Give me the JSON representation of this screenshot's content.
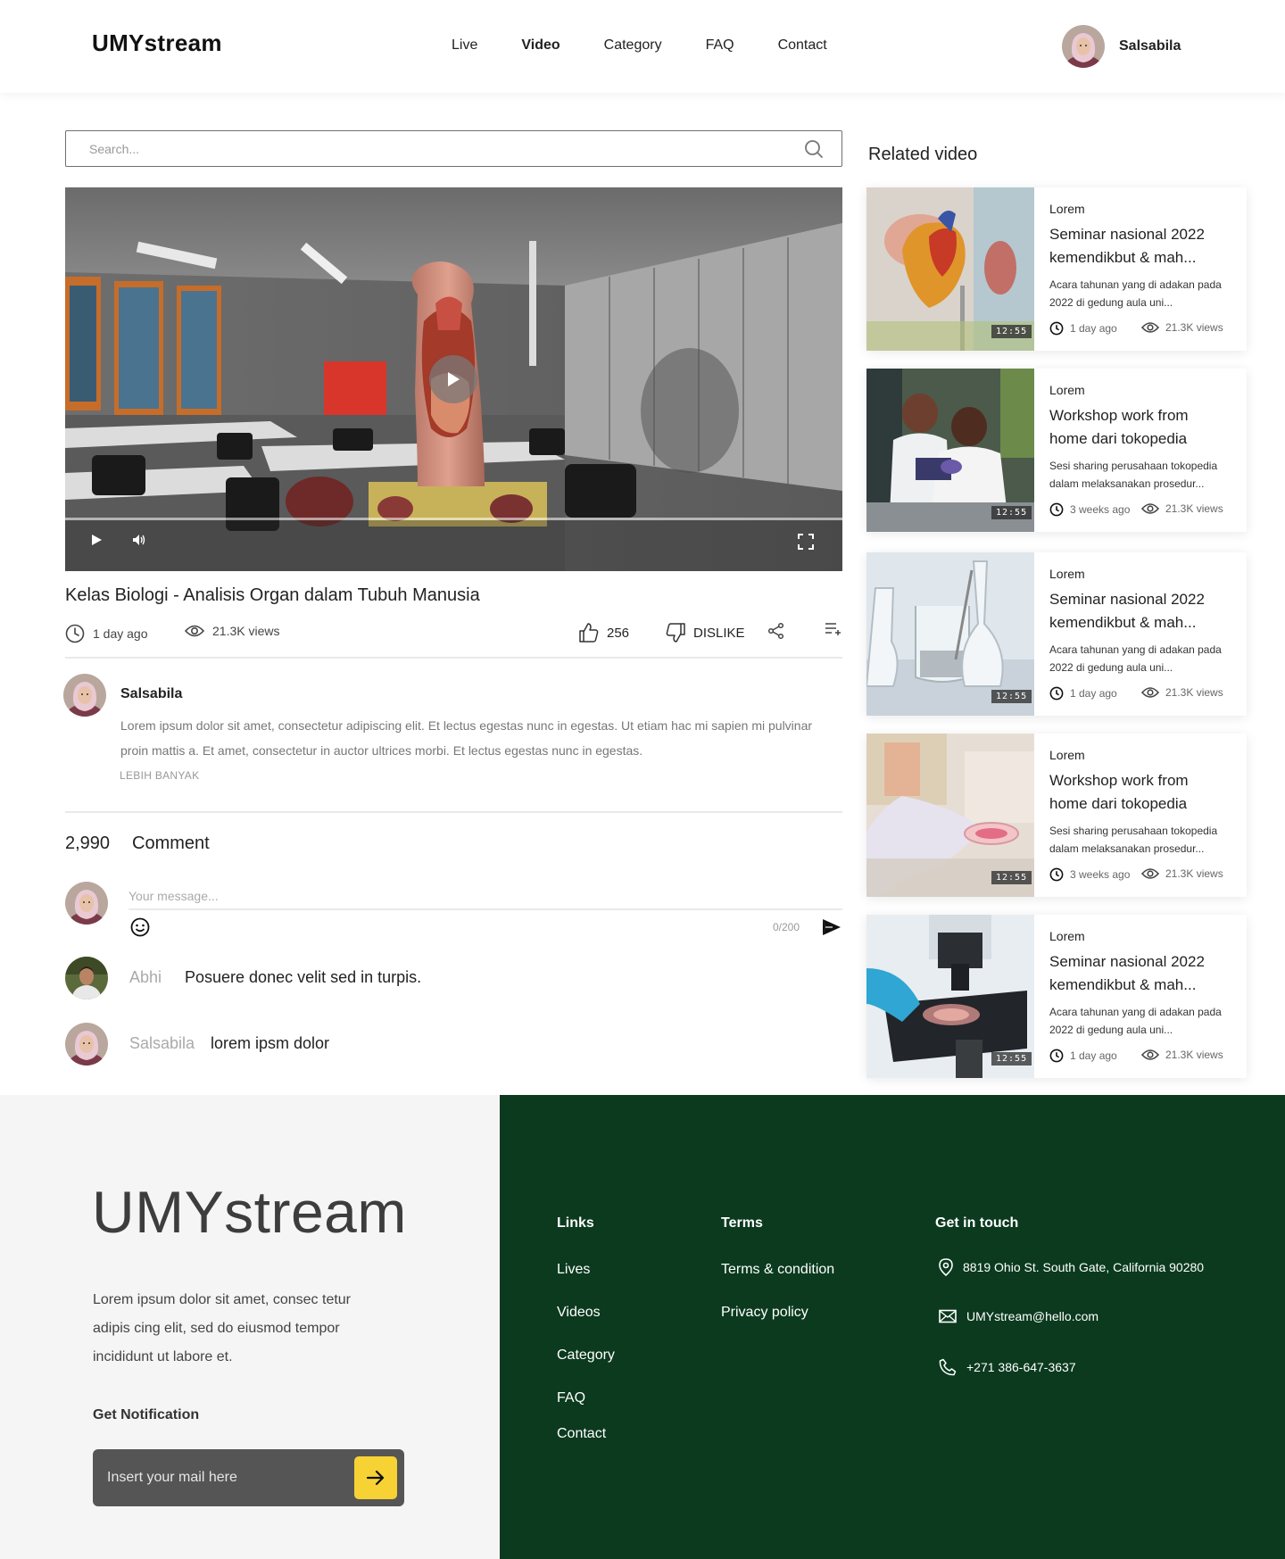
{
  "header": {
    "logo": "UMYstream",
    "nav": [
      "Live",
      "Video",
      "Category",
      "FAQ",
      "Contact"
    ],
    "active_nav": "Video",
    "user_name": "Salsabila"
  },
  "search": {
    "placeholder": "Search..."
  },
  "player": {
    "title": "Kelas Biologi - Analisis Organ dalam Tubuh Manusia",
    "posted": "1 day ago",
    "views": "21.3K views",
    "likes": "256",
    "dislike_label": "DISLIKE"
  },
  "channel": {
    "name": "Salsabila",
    "description": "Lorem ipsum dolor sit amet, consectetur adipiscing elit. Et lectus egestas nunc in egestas. Ut etiam hac mi sapien mi pulvinar proin mattis a. Et amet, consectetur in auctor ultrices morbi. Et lectus egestas nunc in egestas.",
    "more_label": "LEBIH BANYAK"
  },
  "comments": {
    "count": "2,990",
    "label": "Comment",
    "input_placeholder": "Your message...",
    "char_count": "0/200",
    "items": [
      {
        "author": "Abhi",
        "text": "Posuere donec velit sed in turpis."
      },
      {
        "author": "Salsabila",
        "text": "lorem ipsm dolor"
      }
    ]
  },
  "related": {
    "title": "Related video",
    "videos": [
      {
        "category": "Lorem",
        "title": "Seminar nasional 2022 kemendikbut & mah...",
        "desc": "Acara tahunan yang di adakan pada 2022 di gedung aula uni...",
        "posted": "1 day ago",
        "views": "21.3K views",
        "duration": "12:55"
      },
      {
        "category": "Lorem",
        "title": "Workshop work from home dari tokopedia",
        "desc": "Sesi sharing perusahaan tokopedia dalam melaksanakan prosedur...",
        "posted": "3 weeks ago",
        "views": "21.3K views",
        "duration": "12:55"
      },
      {
        "category": "Lorem",
        "title": "Seminar nasional 2022 kemendikbut & mah...",
        "desc": "Acara tahunan yang di adakan pada 2022 di gedung aula uni...",
        "posted": "1 day ago",
        "views": "21.3K views",
        "duration": "12:55"
      },
      {
        "category": "Lorem",
        "title": "Workshop work from home dari tokopedia",
        "desc": "Sesi sharing perusahaan tokopedia dalam melaksanakan prosedur...",
        "posted": "3 weeks ago",
        "views": "21.3K views",
        "duration": "12:55"
      },
      {
        "category": "Lorem",
        "title": "Seminar nasional 2022 kemendikbut & mah...",
        "desc": "Acara tahunan yang di adakan pada 2022 di gedung aula uni...",
        "posted": "1 day ago",
        "views": "21.3K views",
        "duration": "12:55"
      }
    ]
  },
  "footer": {
    "logo": "UMYstream",
    "description": "Lorem ipsum dolor sit amet, consec tetur adipis cing elit, sed do eiusmod tempor incididunt ut labore et.",
    "notification_label": "Get Notification",
    "mail_placeholder": "Insert your mail here",
    "links_head": "Links",
    "links": [
      "Lives",
      "Videos",
      "Category",
      "FAQ",
      "Contact"
    ],
    "terms_head": "Terms",
    "terms": [
      "Terms & condition",
      "Privacy policy"
    ],
    "contact_head": "Get in touch",
    "address": "8819 Ohio St. South Gate, California 90280",
    "email": "UMYstream@hello.com",
    "phone": "+271 386-647-3637"
  },
  "colors": {
    "footer_dark": "#0b3a1f",
    "footer_light": "#f5f5f5",
    "accent_yellow": "#f6d234",
    "mail_box": "#555555"
  },
  "icons": [
    "search-icon",
    "play-icon",
    "volume-icon",
    "fullscreen-icon",
    "clock-icon",
    "eye-icon",
    "thumbs-up-icon",
    "thumbs-down-icon",
    "share-icon",
    "playlist-add-icon",
    "emoji-icon",
    "send-icon",
    "arrow-right-icon",
    "location-icon",
    "mail-icon",
    "phone-icon"
  ]
}
